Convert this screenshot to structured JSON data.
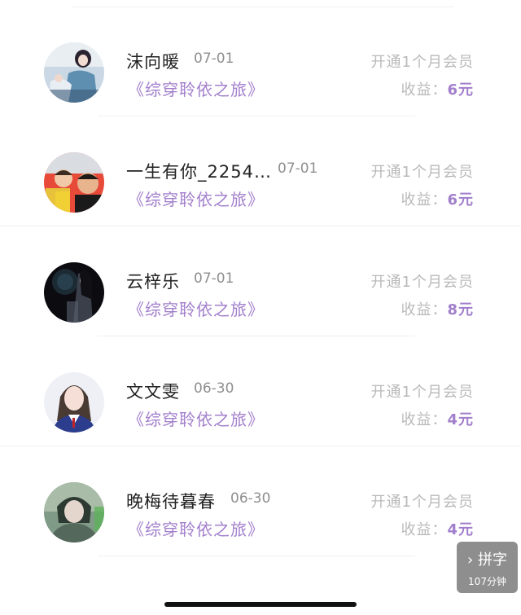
{
  "records": [
    {
      "name": "沫向暖",
      "date": "07-01",
      "book": "《综穿聆依之旅》",
      "plan": "开通1个月会员",
      "earn_label": "收益：",
      "earn_value": "6元"
    },
    {
      "name": "一生有你_2254…",
      "date": "07-01",
      "book": "《综穿聆依之旅》",
      "plan": "开通1个月会员",
      "earn_label": "收益：",
      "earn_value": "6元"
    },
    {
      "name": "云梓乐",
      "date": "07-01",
      "book": "《综穿聆依之旅》",
      "plan": "开通1个月会员",
      "earn_label": "收益：",
      "earn_value": "8元"
    },
    {
      "name": "文文雯",
      "date": "06-30",
      "book": "《综穿聆依之旅》",
      "plan": "开通1个月会员",
      "earn_label": "收益：",
      "earn_value": "4元"
    },
    {
      "name": "晚梅待暮春",
      "date": "06-30",
      "book": "《综穿聆依之旅》",
      "plan": "开通1个月会员",
      "earn_label": "收益：",
      "earn_value": "4元"
    }
  ],
  "float_button": {
    "label": "› 拼字",
    "sub": "107分钟"
  },
  "colors": {
    "accent": "#a27fcc",
    "muted": "#b9b9b9",
    "date": "#8f8f8f"
  }
}
